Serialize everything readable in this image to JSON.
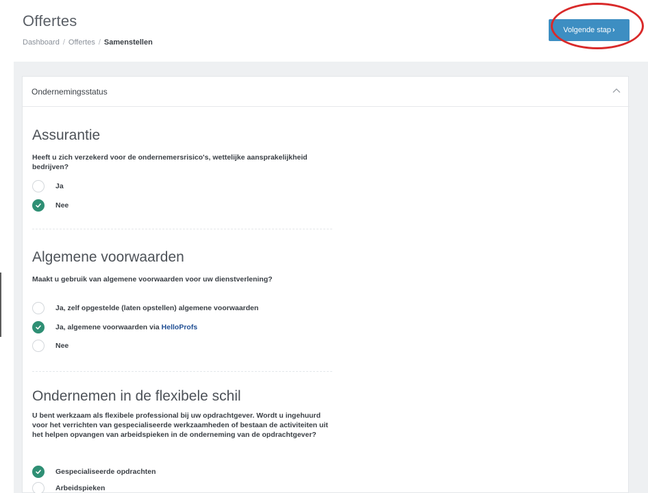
{
  "header": {
    "title": "Offertes",
    "breadcrumb": [
      "Dashboard",
      "Offertes",
      "Samenstellen"
    ],
    "next_button": "Volgende stap"
  },
  "colors": {
    "primary_button": "#3d8ec2",
    "check_green": "#2f8f74",
    "annotation_red": "#d92a2a",
    "brand_link": "#1f4e93"
  },
  "card": {
    "title": "Ondernemingsstatus",
    "sections": [
      {
        "title": "Assurantie",
        "question": "Heeft u zich verzekerd voor de ondernemersrisico's, wettelijke aansprakelijkheid bedrijven?",
        "options": [
          {
            "label": "Ja",
            "checked": false
          },
          {
            "label": "Nee",
            "checked": true
          }
        ]
      },
      {
        "title": "Algemene voorwaarden",
        "question": "Maakt u gebruik van algemene voorwaarden voor uw dienstverlening?",
        "options": [
          {
            "label": "Ja, zelf opgestelde (laten opstellen) algemene voorwaarden",
            "checked": false
          },
          {
            "label": "Ja, algemene voorwaarden via ",
            "brand": "HelloProfs",
            "checked": true
          },
          {
            "label": "Nee",
            "checked": false
          }
        ]
      },
      {
        "title": "Ondernemen in de flexibele schil",
        "question": "U bent werkzaam als flexibele professional bij uw opdrachtgever. Wordt u ingehuurd voor het verrichten van gespecialiseerde werkzaamheden of bestaan de activiteiten uit het helpen opvangen van arbeidspieken in de onderneming van de opdrachtgever?",
        "options": [
          {
            "label": "Gespecialiseerde opdrachten",
            "checked": true
          },
          {
            "label": "Arbeidspieken",
            "checked": false
          }
        ]
      }
    ]
  }
}
